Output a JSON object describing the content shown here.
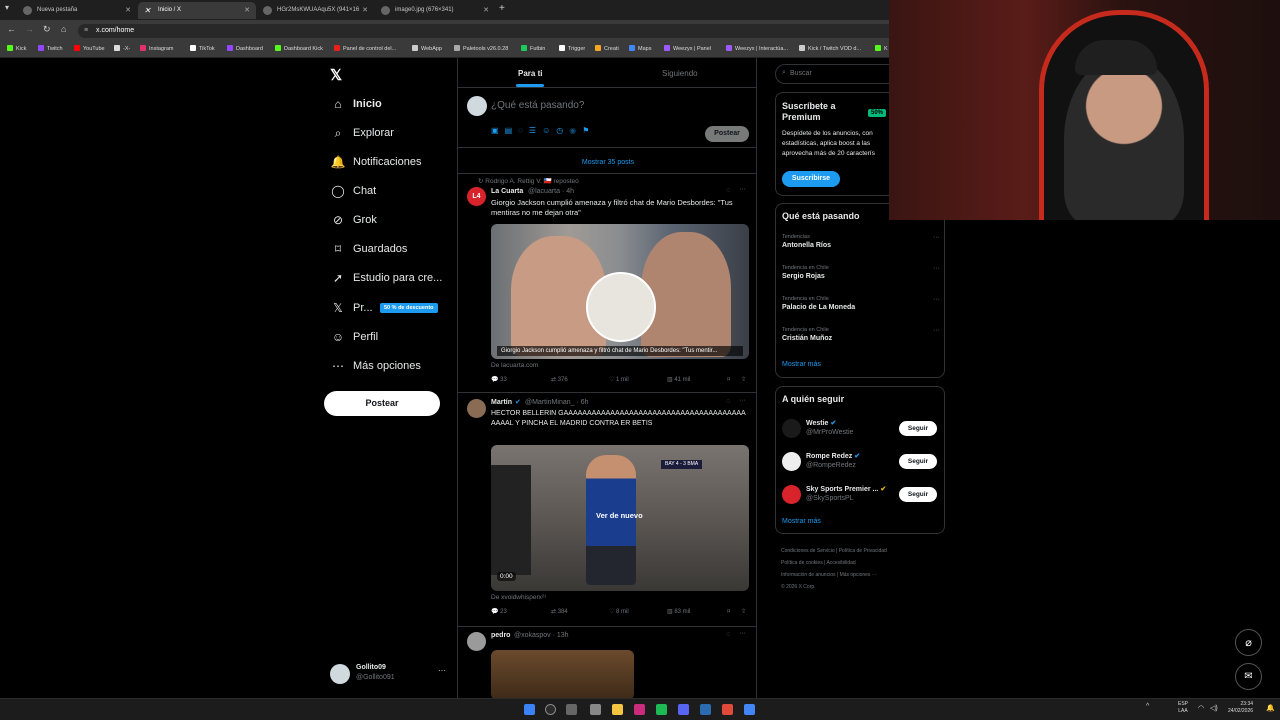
{
  "browser": {
    "tabs": [
      {
        "title": "Nueva pestaña"
      },
      {
        "title": "Inicio / X"
      },
      {
        "title": "HGr2MsKWUAAqu5X (941×16"
      },
      {
        "title": "image0.jpg (676×341)"
      }
    ],
    "url": "x.com/home",
    "bookmarks": [
      "Kick",
      "Twitch",
      "YouTube",
      "-X-",
      "Instagram",
      "TikTok",
      "Dashboard",
      "Dashboard Kick",
      "Panel de control del...",
      "WebApp",
      "Paletools v26.0.28",
      "Futbin",
      "Trigger",
      "Creati",
      "Maps",
      "Weezyx | Panel",
      "Weezyx | Interactúa...",
      "Kick / Twitch VOD d...",
      "K"
    ]
  },
  "nav": {
    "items": [
      {
        "label": "Inicio"
      },
      {
        "label": "Explorar"
      },
      {
        "label": "Notificaciones"
      },
      {
        "label": "Chat"
      },
      {
        "label": "Grok"
      },
      {
        "label": "Guardados"
      },
      {
        "label": "Estudio para cre..."
      },
      {
        "label": "Pr..."
      },
      {
        "label": "Perfil"
      },
      {
        "label": "Más opciones"
      }
    ],
    "premium_badge": "50 % de descuento",
    "post_button": "Postear",
    "account": {
      "name": "Gollito09",
      "handle": "@Gollito091"
    }
  },
  "feed": {
    "tabs": [
      "Para ti",
      "Siguiendo"
    ],
    "composer_placeholder": "¿Qué está pasando?",
    "composer_post": "Postear",
    "show_posts": "Mostrar 35 posts",
    "posts": [
      {
        "repost_by": "Rodrigo A. Rettig V. 🇨🇱 reposteó",
        "author": "La Cuarta",
        "handle": "@lacuarta · 4h",
        "text": "Giorgio Jackson cumplió amenaza y filtró chat de Mario Desbordes: \"Tus mentiras no me dejan otra\"",
        "media_caption": "Giorgio Jackson cumplió amenaza y filtró chat de Mario Desbordes: \"Tus mentir...",
        "source": "De lacuarta.com",
        "stats": [
          "33",
          "376",
          "1 mil",
          "41 mil"
        ]
      },
      {
        "author": "Martín",
        "handle": "@MartinMinan_ · 6h",
        "text": "HECTOR BELLERIN GAAAAAAAAAAAAAAAAAAAAAAAAAAAAAAAAAAAAAAAAAAAL Y PINCHA EL MADRID CONTRA ER BETIS",
        "video_label": "Ver de nuevo",
        "video_time": "0:00",
        "scoreboard": "BAY 4 - 3 BMA",
        "source": "De xvoidwhisperx²¹",
        "stats": [
          "23",
          "384",
          "8 mil",
          "83 mil"
        ]
      },
      {
        "author": "pedro",
        "handle": "@xokaspov · 13h"
      }
    ]
  },
  "sidebar": {
    "search_placeholder": "Buscar",
    "premium": {
      "title": "Suscríbete a Premium",
      "badge": "50%",
      "body": "Despídete de los anuncios, con estadísticas, aplica boost a las aprovecha más de 20 caracterís",
      "button": "Suscribirse"
    },
    "trending": {
      "title": "Qué está pasando",
      "items": [
        {
          "context": "Tendencias",
          "name": "Antonella Ríos"
        },
        {
          "context": "Tendencia en Chile",
          "name": "Sergio Rojas"
        },
        {
          "context": "Tendencia en Chile",
          "name": "Palacio de La Moneda"
        },
        {
          "context": "Tendencia en Chile",
          "name": "Cristián Muñoz"
        }
      ],
      "more": "Mostrar más"
    },
    "who_to_follow": {
      "title": "A quién seguir",
      "items": [
        {
          "name": "Westie",
          "handle": "@MrProWestie"
        },
        {
          "name": "Rompe Redez",
          "handle": "@RompeRedez"
        },
        {
          "name": "Sky Sports Premier ...",
          "handle": "@SkySportsPL"
        }
      ],
      "follow": "Seguir",
      "more": "Mostrar más"
    },
    "footer": {
      "line1": [
        "Condiciones de Servicio",
        "Política de Privacidad"
      ],
      "line2": [
        "Política de cookies",
        "Accesibilidad"
      ],
      "line3": [
        "Información de anuncios",
        "Más opciones ···"
      ],
      "copyright": "© 2026 X Corp."
    }
  },
  "taskbar": {
    "lang": "ESP",
    "lang_sub": "LAA",
    "time": "23:34",
    "date": "24/02/2026"
  },
  "colors": {
    "accent": "#1d9bf0",
    "background": "#000000",
    "border": "#2f3336",
    "muted": "#71767b",
    "premium_badge": "#00ba7c"
  }
}
